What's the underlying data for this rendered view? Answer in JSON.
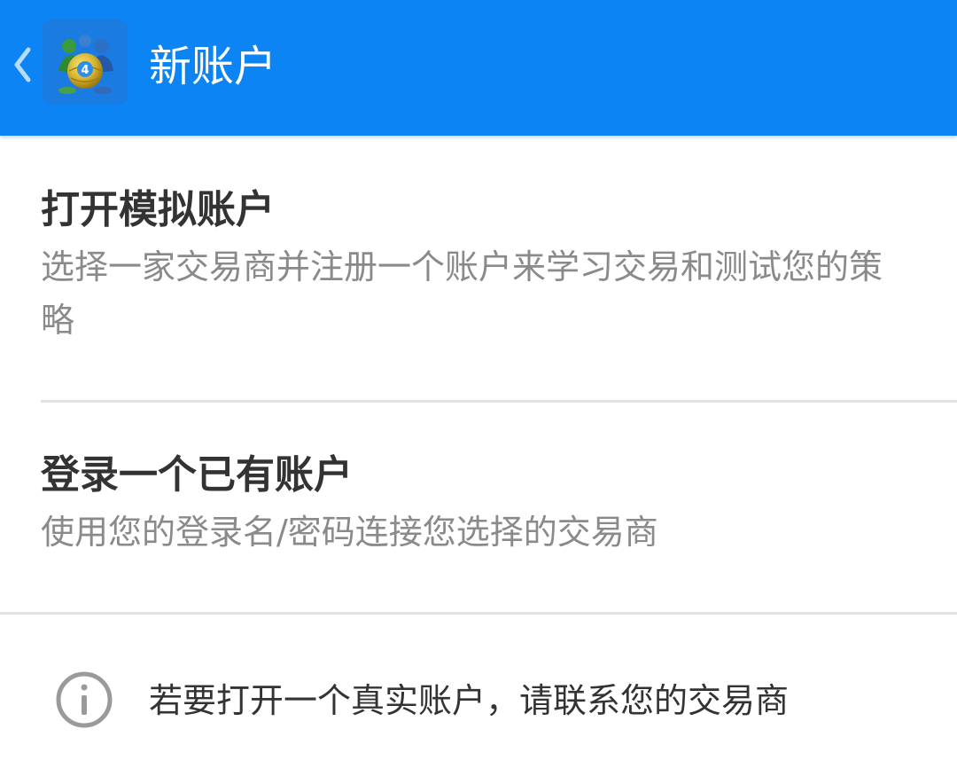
{
  "appbar": {
    "title": "新账户",
    "back_icon": "chevron-left-icon",
    "logo_icon": "metatrader-4-logo",
    "logo_mark": "4",
    "background_color": "#0d84f3"
  },
  "options": [
    {
      "title": "打开模拟账户",
      "description": "选择一家交易商并注册一个账户来学习交易和测试您的策略"
    },
    {
      "title": "登录一个已有账户",
      "description": "使用您的登录名/密码连接您选择的交易商"
    }
  ],
  "info": {
    "icon": "info-icon",
    "text": "若要打开一个真实账户，请联系您的交易商"
  }
}
